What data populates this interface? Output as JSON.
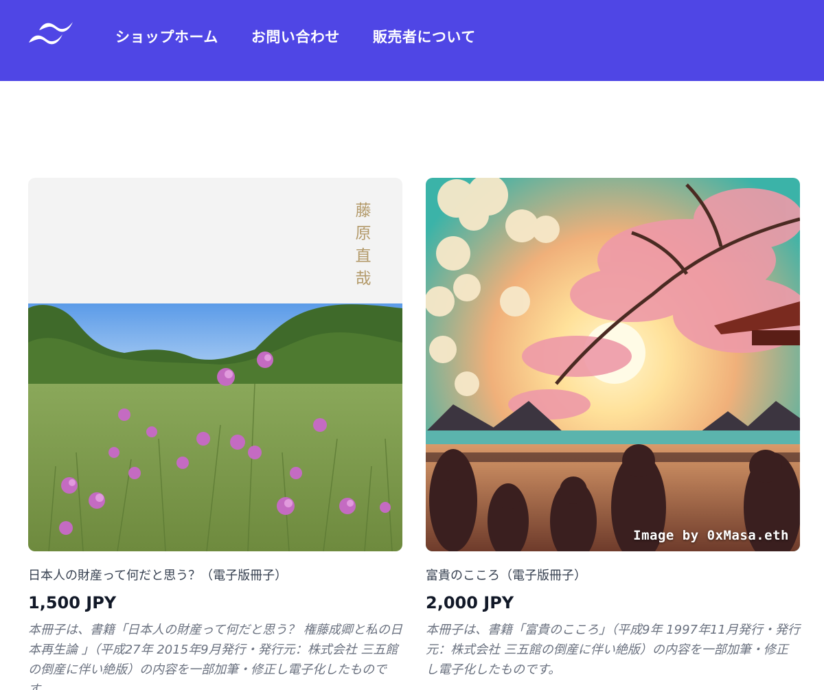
{
  "header": {
    "logo_icon": "wave-logo-icon",
    "background_color": "#4f46e5",
    "nav": [
      {
        "label": "ショップホーム"
      },
      {
        "label": "お問い合わせ"
      },
      {
        "label": "販売者について"
      }
    ]
  },
  "products": [
    {
      "cover_author": "藤原直哉",
      "title": "日本人の財産って何だと思う？（電子版冊子）",
      "price": "1,500 JPY",
      "description": "本冊子は、書籍「日本人の財産って何だと思う？ 権藤成卿と私の日本再生論 」（平成27年 2015年9月発行・発行元：株式会社 三五館の倒産に伴い絶版）の内容を一部加筆・修正し電子化したものです。"
    },
    {
      "image_credit": "Image by 0xMasa.eth",
      "title": "富貴のこころ（電子版冊子）",
      "price": "2,000 JPY",
      "description": "本冊子は、書籍「富貴のこころ」（平成9年 1997年11月発行・発行元：株式会社 三五館の倒産に伴い絶版）の内容を一部加筆・修正し電子化したものです。"
    }
  ]
}
